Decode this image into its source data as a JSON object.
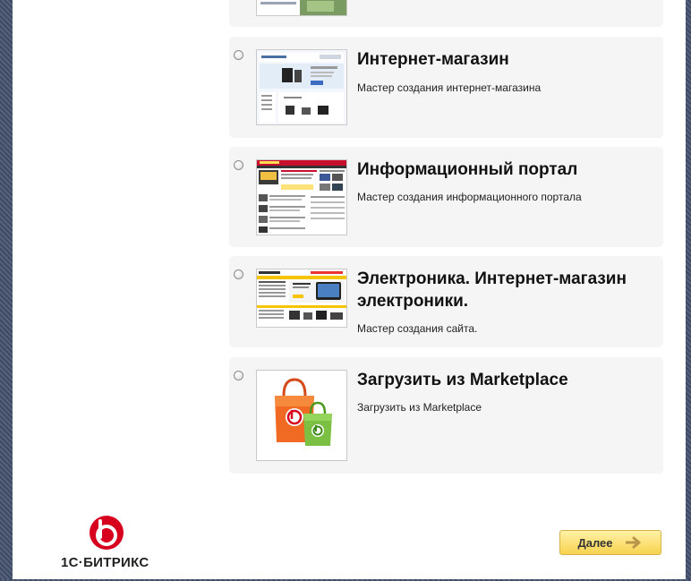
{
  "templates": [
    {
      "title": "",
      "desc": ""
    },
    {
      "title": "Интернет-магазин",
      "desc": "Мастер создания интернет-магазина"
    },
    {
      "title": "Информационный портал",
      "desc": "Мастер создания информационного портала"
    },
    {
      "title": "Электроника. Интернет-магазин электроники.",
      "desc": "Мастер создания сайта."
    },
    {
      "title": "Загрузить из Marketplace",
      "desc": "Загрузить из Marketplace"
    }
  ],
  "footer": {
    "logo_text": "1С·БИТРИКС",
    "next_label": "Далее"
  },
  "colors": {
    "accent_red": "#d7001e",
    "button_yellow": "#f7d24e"
  }
}
